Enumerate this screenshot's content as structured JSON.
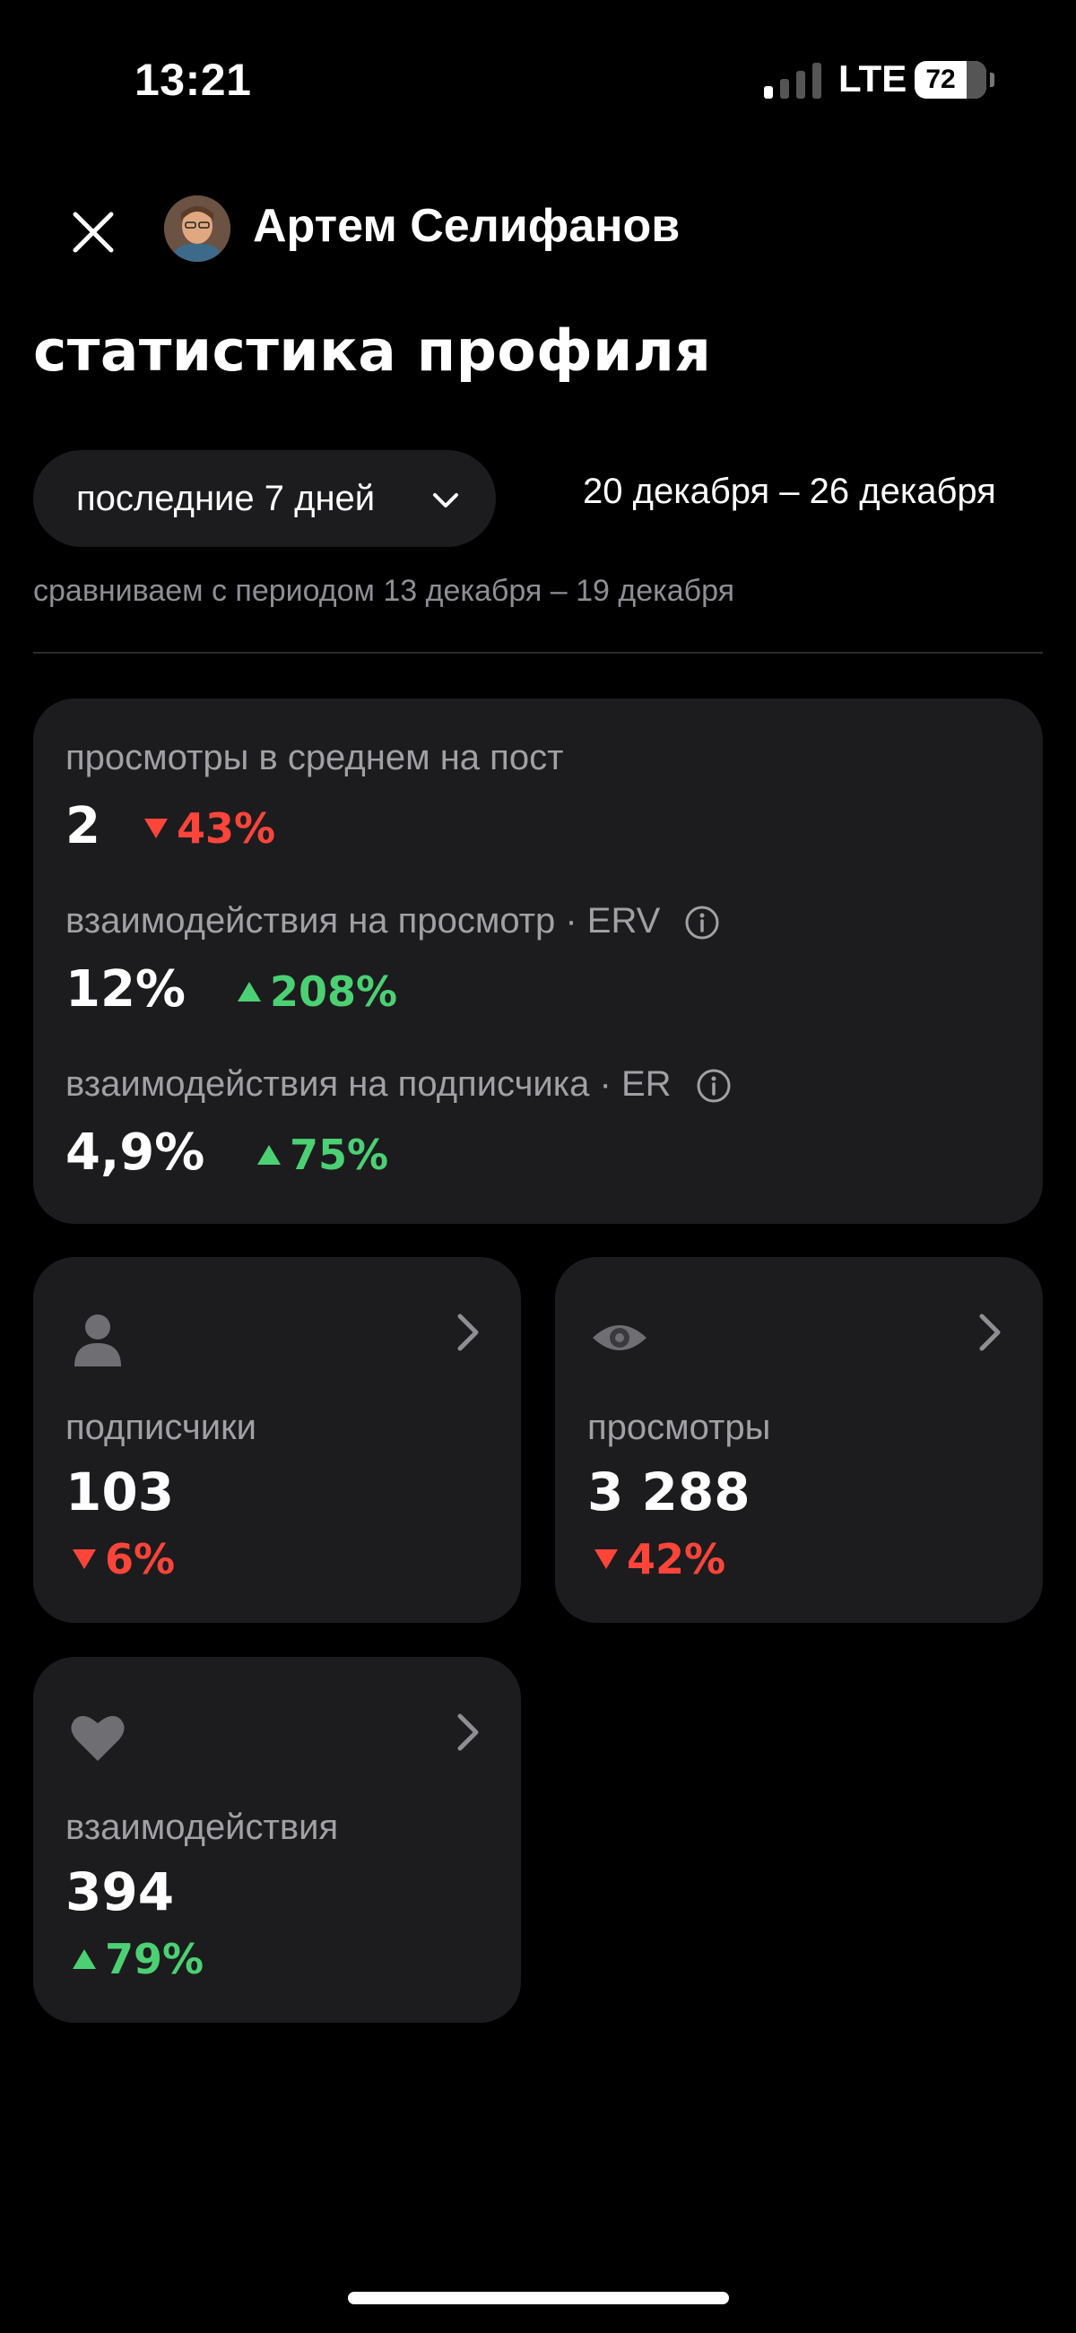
{
  "status_bar": {
    "time": "13:21",
    "network": "LTE",
    "battery": 72
  },
  "header": {
    "profile_name": "Артем Селифанов"
  },
  "page_title": "статистика профиля",
  "period": {
    "selected": "последние 7 дней",
    "date_range": "20 декабря – 26 декабря",
    "compare_text": "сравниваем с периодом 13 декабря – 19 декабря"
  },
  "summary": [
    {
      "label": "просмотры в среднем на пост",
      "value": "2",
      "delta": "43%",
      "direction": "down",
      "info": false
    },
    {
      "label": "взаимодействия на просмотр · ERV",
      "value": "12%",
      "delta": "208%",
      "direction": "up",
      "info": true
    },
    {
      "label": "взаимодействия на подписчика · ER",
      "value": "4,9%",
      "delta": "75%",
      "direction": "up",
      "info": true
    }
  ],
  "cards": [
    {
      "icon": "person-icon",
      "label": "подписчики",
      "value": "103",
      "delta": "6%",
      "direction": "down"
    },
    {
      "icon": "eye-icon",
      "label": "просмотры",
      "value": "3 288",
      "delta": "42%",
      "direction": "down"
    },
    {
      "icon": "heart-icon",
      "label": "взаимодействия",
      "value": "394",
      "delta": "79%",
      "direction": "up"
    }
  ],
  "colors": {
    "down": "#ff453a",
    "up": "#4cd074",
    "card": "#1c1c1e",
    "muted": "#a0a0a5"
  }
}
